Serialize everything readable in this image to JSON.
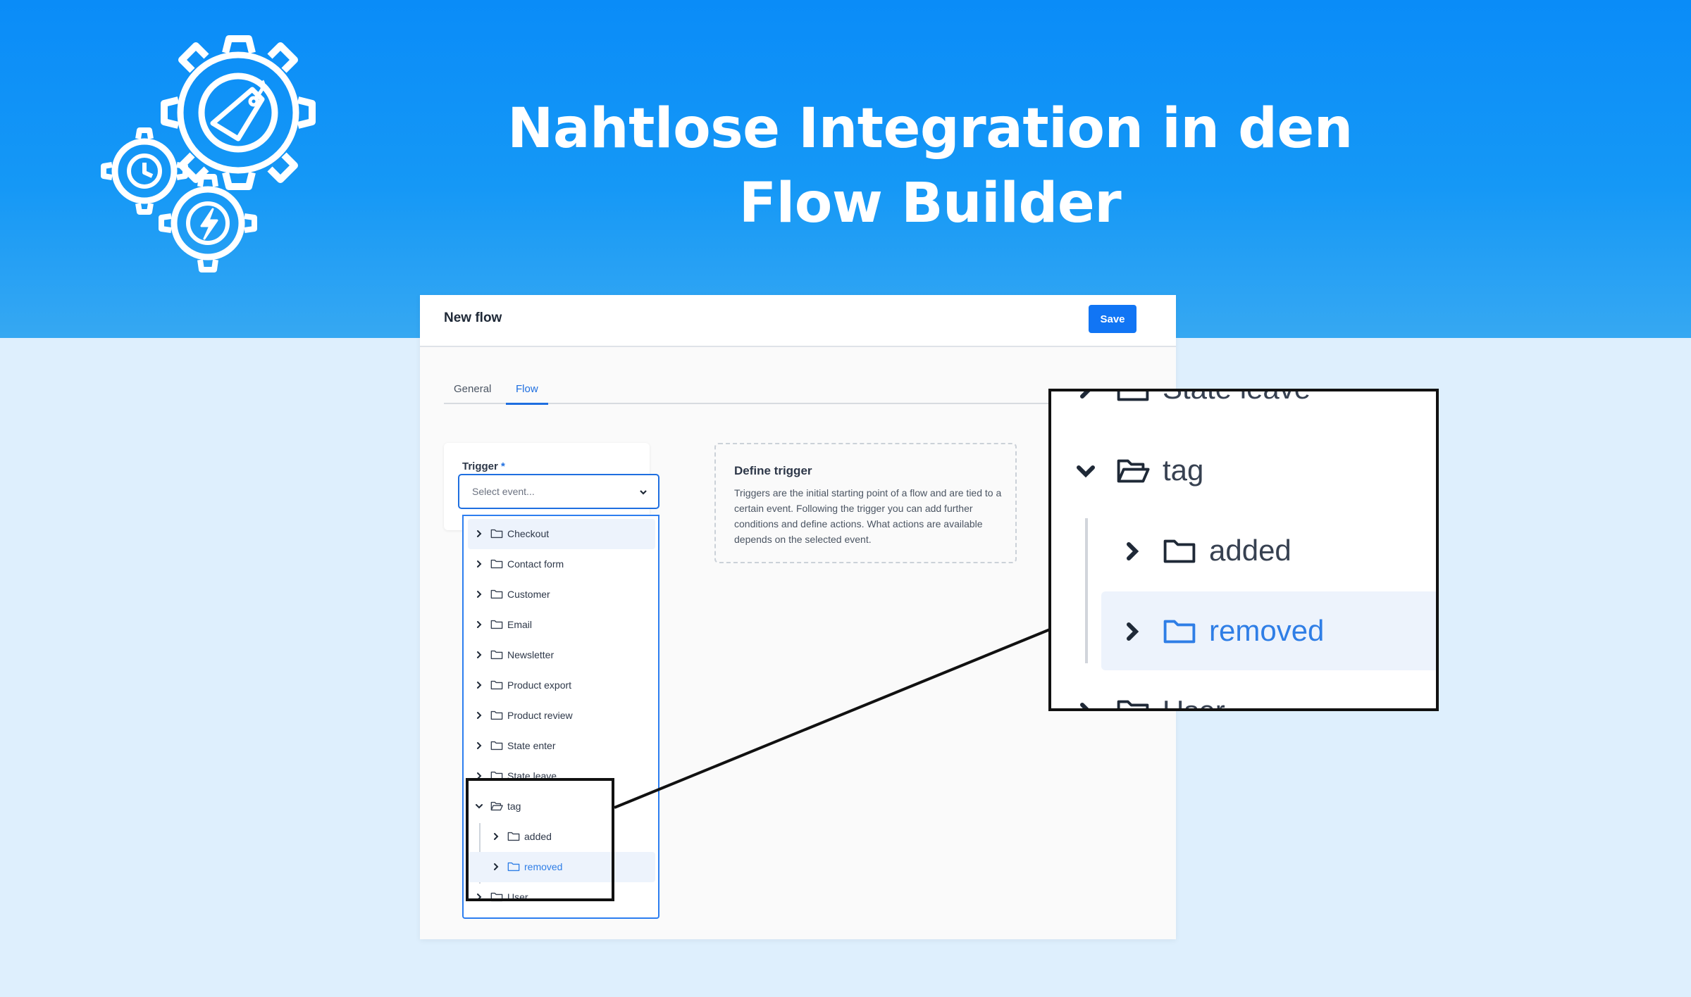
{
  "headline": {
    "line1": "Nahtlose Integration in den",
    "line2": "Flow Builder"
  },
  "window": {
    "title": "New flow",
    "save_label": "Save"
  },
  "tabs": [
    {
      "label": "General"
    },
    {
      "label": "Flow"
    }
  ],
  "active_tab": "Flow",
  "trigger": {
    "label": "Trigger",
    "required_mark": "*",
    "placeholder": "Select event..."
  },
  "dropdown_items": [
    {
      "label": "Checkout",
      "expanded": false
    },
    {
      "label": "Contact form",
      "expanded": false
    },
    {
      "label": "Customer",
      "expanded": false
    },
    {
      "label": "Email",
      "expanded": false
    },
    {
      "label": "Newsletter",
      "expanded": false
    },
    {
      "label": "Product export",
      "expanded": false
    },
    {
      "label": "Product review",
      "expanded": false
    },
    {
      "label": "State enter",
      "expanded": false
    },
    {
      "label": "State leave",
      "expanded": false
    },
    {
      "label": "tag",
      "expanded": true
    },
    {
      "label": "added",
      "expanded": false
    },
    {
      "label": "removed",
      "expanded": false,
      "selected": true
    },
    {
      "label": "User",
      "expanded": false
    }
  ],
  "define_trigger": {
    "title": "Define trigger",
    "text": "Triggers are the initial starting point of a flow and are tied to a certain event. Following the trigger you can add further conditions and define actions. What actions are available depends on the selected event."
  },
  "zoom": {
    "items": [
      "State leave",
      "tag",
      "added",
      "removed",
      "User"
    ]
  },
  "icons": {
    "gears": "gears-icon",
    "tag": "price-tag-icon",
    "clock": "history-clock-icon",
    "bolt": "lightning-icon"
  },
  "colors": {
    "accent": "#1175f4",
    "banner": "#0a8cf8",
    "highlight": "#2f7ee6"
  }
}
